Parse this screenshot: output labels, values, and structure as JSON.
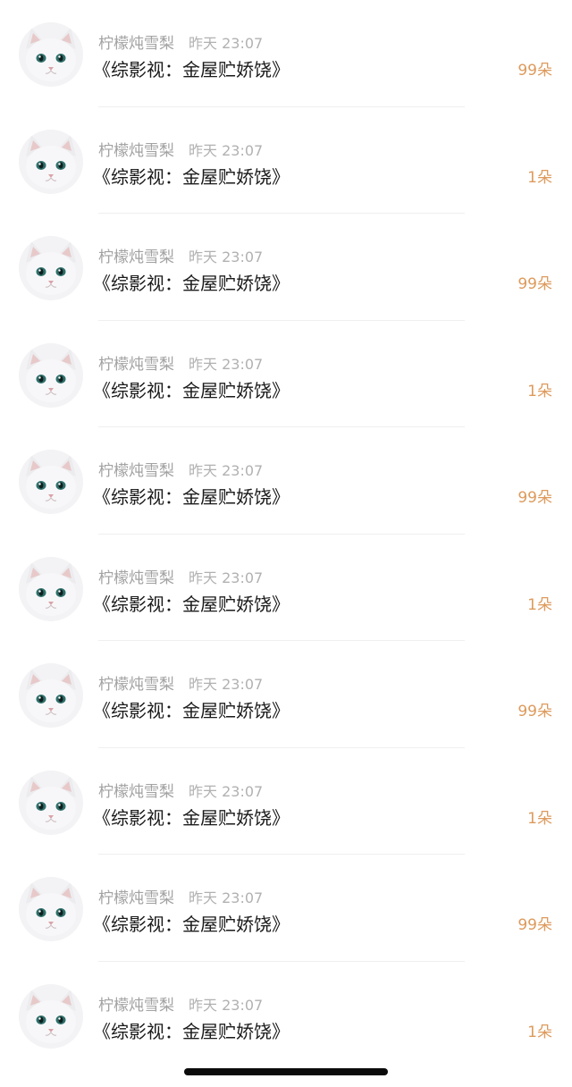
{
  "items": [
    {
      "author": "柠檬炖雪梨",
      "time": "昨天 23:07",
      "title": "《综影视：金屋贮娇饶》",
      "amount": "99朵"
    },
    {
      "author": "柠檬炖雪梨",
      "time": "昨天 23:07",
      "title": "《综影视：金屋贮娇饶》",
      "amount": "1朵"
    },
    {
      "author": "柠檬炖雪梨",
      "time": "昨天 23:07",
      "title": "《综影视：金屋贮娇饶》",
      "amount": "99朵"
    },
    {
      "author": "柠檬炖雪梨",
      "time": "昨天 23:07",
      "title": "《综影视：金屋贮娇饶》",
      "amount": "1朵"
    },
    {
      "author": "柠檬炖雪梨",
      "time": "昨天 23:07",
      "title": "《综影视：金屋贮娇饶》",
      "amount": "99朵"
    },
    {
      "author": "柠檬炖雪梨",
      "time": "昨天 23:07",
      "title": "《综影视：金屋贮娇饶》",
      "amount": "1朵"
    },
    {
      "author": "柠檬炖雪梨",
      "time": "昨天 23:07",
      "title": "《综影视：金屋贮娇饶》",
      "amount": "99朵"
    },
    {
      "author": "柠檬炖雪梨",
      "time": "昨天 23:07",
      "title": "《综影视：金屋贮娇饶》",
      "amount": "1朵"
    },
    {
      "author": "柠檬炖雪梨",
      "time": "昨天 23:07",
      "title": "《综影视：金屋贮娇饶》",
      "amount": "99朵"
    },
    {
      "author": "柠檬炖雪梨",
      "time": "昨天 23:07",
      "title": "《综影视：金屋贮娇饶》",
      "amount": "1朵"
    }
  ],
  "avatar_icon": "white-cat-avatar",
  "colors": {
    "amount": "#dd9a5c",
    "meta": "#a2a2a2",
    "title": "#1a1a1a",
    "divider": "#efefef"
  }
}
